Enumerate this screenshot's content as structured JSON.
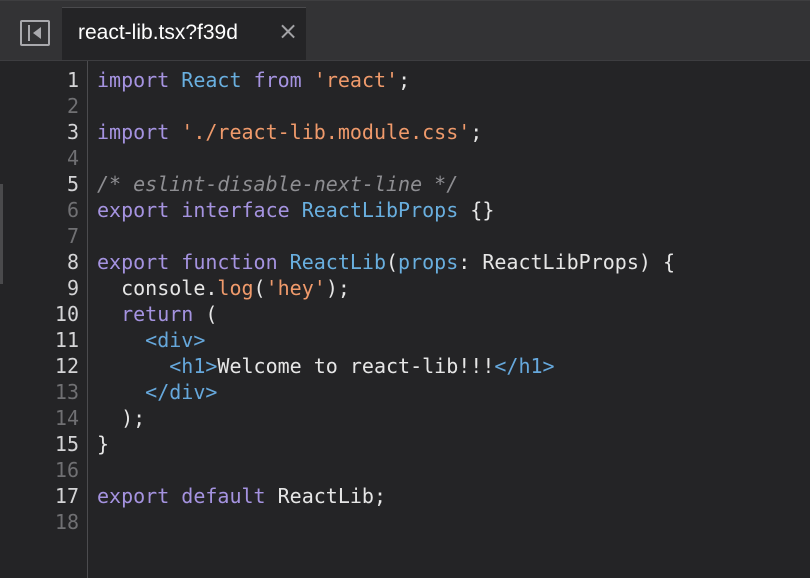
{
  "tab": {
    "label": "react-lib.tsx?f39d",
    "close_glyph": "×"
  },
  "panel_toggle": {
    "icon": "sidebar-collapse-icon"
  },
  "colors": {
    "background": "#242426",
    "tabbar": "#333335",
    "keyword": "#a593e0",
    "type": "#69afdf",
    "string": "#ef9a6b",
    "comment": "#8e8e92"
  },
  "lines": [
    {
      "num": "1",
      "tokens": [
        [
          "kw",
          "import"
        ],
        [
          "pl",
          " "
        ],
        [
          "ty",
          "React"
        ],
        [
          "pl",
          " "
        ],
        [
          "kw",
          "from"
        ],
        [
          "pl",
          " "
        ],
        [
          "str",
          "'react'"
        ],
        [
          "pl",
          ";"
        ]
      ]
    },
    {
      "num": "2",
      "tokens": []
    },
    {
      "num": "3",
      "tokens": [
        [
          "kw",
          "import"
        ],
        [
          "pl",
          " "
        ],
        [
          "str",
          "'./react-lib.module.css'"
        ],
        [
          "pl",
          ";"
        ]
      ]
    },
    {
      "num": "4",
      "tokens": []
    },
    {
      "num": "5",
      "tokens": [
        [
          "com",
          "/* eslint-disable-next-line */"
        ]
      ]
    },
    {
      "num": "6",
      "tokens": [
        [
          "kw",
          "export"
        ],
        [
          "pl",
          " "
        ],
        [
          "kw",
          "interface"
        ],
        [
          "pl",
          " "
        ],
        [
          "ty",
          "ReactLibProps"
        ],
        [
          "pl",
          " {}"
        ]
      ]
    },
    {
      "num": "7",
      "tokens": []
    },
    {
      "num": "8",
      "tokens": [
        [
          "kw",
          "export"
        ],
        [
          "pl",
          " "
        ],
        [
          "kw",
          "function"
        ],
        [
          "pl",
          " "
        ],
        [
          "ty",
          "ReactLib"
        ],
        [
          "pl",
          "("
        ],
        [
          "ty",
          "props"
        ],
        [
          "pl",
          ": ReactLibProps) {"
        ]
      ]
    },
    {
      "num": "9",
      "tokens": [
        [
          "pl",
          "  console."
        ],
        [
          "fn",
          "log"
        ],
        [
          "pl",
          "("
        ],
        [
          "str",
          "'hey'"
        ],
        [
          "pl",
          ");"
        ]
      ]
    },
    {
      "num": "10",
      "tokens": [
        [
          "pl",
          "  "
        ],
        [
          "kw",
          "return"
        ],
        [
          "pl",
          " ("
        ]
      ]
    },
    {
      "num": "11",
      "tokens": [
        [
          "pl",
          "    "
        ],
        [
          "tag",
          "<div>"
        ]
      ]
    },
    {
      "num": "12",
      "tokens": [
        [
          "pl",
          "      "
        ],
        [
          "tag",
          "<h1>"
        ],
        [
          "pl",
          "Welcome to react-lib!!!"
        ],
        [
          "tag",
          "</h1>"
        ]
      ]
    },
    {
      "num": "13",
      "tokens": [
        [
          "pl",
          "    "
        ],
        [
          "tag",
          "</div>"
        ]
      ]
    },
    {
      "num": "14",
      "tokens": [
        [
          "pl",
          "  );"
        ]
      ]
    },
    {
      "num": "15",
      "tokens": [
        [
          "pl",
          "}"
        ]
      ]
    },
    {
      "num": "16",
      "tokens": []
    },
    {
      "num": "17",
      "tokens": [
        [
          "kw",
          "export"
        ],
        [
          "pl",
          " "
        ],
        [
          "kw",
          "default"
        ],
        [
          "pl",
          " ReactLib;"
        ]
      ]
    },
    {
      "num": "18",
      "tokens": []
    }
  ]
}
